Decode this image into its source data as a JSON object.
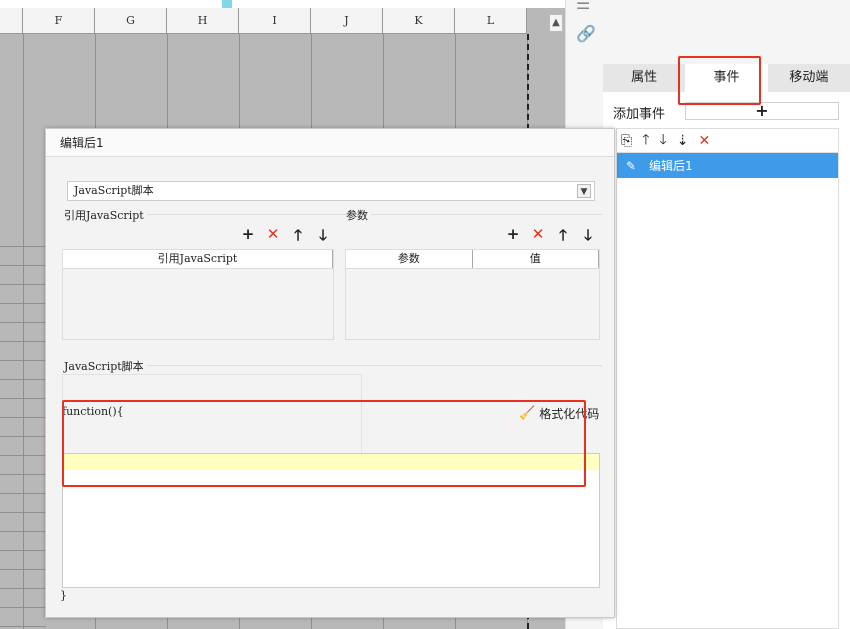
{
  "sheet": {
    "columns": [
      "F",
      "G",
      "H",
      "I",
      "J",
      "K",
      "L"
    ],
    "scroll_up": "▲"
  },
  "right_panel": {
    "tabs": [
      {
        "label": "属性"
      },
      {
        "label": "事件"
      },
      {
        "label": "移动端"
      }
    ],
    "add_event_label": "添加事件",
    "add_event_button": "+",
    "toolbar": {
      "copy": "⎘",
      "up": "🡑",
      "down": "🡓",
      "sort": "⇣",
      "delete": "✕"
    },
    "events": [
      {
        "name": "编辑后1"
      }
    ]
  },
  "dialog": {
    "title": "编辑后1",
    "type_select": "JavaScript脚本",
    "ref_js_title": "引用JavaScript",
    "params_title": "参数",
    "ref_js_column": "引用JavaScript",
    "params_columns": [
      "参数",
      "值"
    ],
    "tools": {
      "add": "+",
      "delete": "✕",
      "up": "🡑",
      "down": "🡓"
    },
    "script_title": "JavaScript脚本",
    "code_open": "function(){",
    "code_close": "}",
    "format_button": "格式化代码"
  },
  "colors": {
    "highlight_red": "#e53222",
    "selected_blue": "#3d9be9",
    "editor_line": "#ffffbf"
  }
}
